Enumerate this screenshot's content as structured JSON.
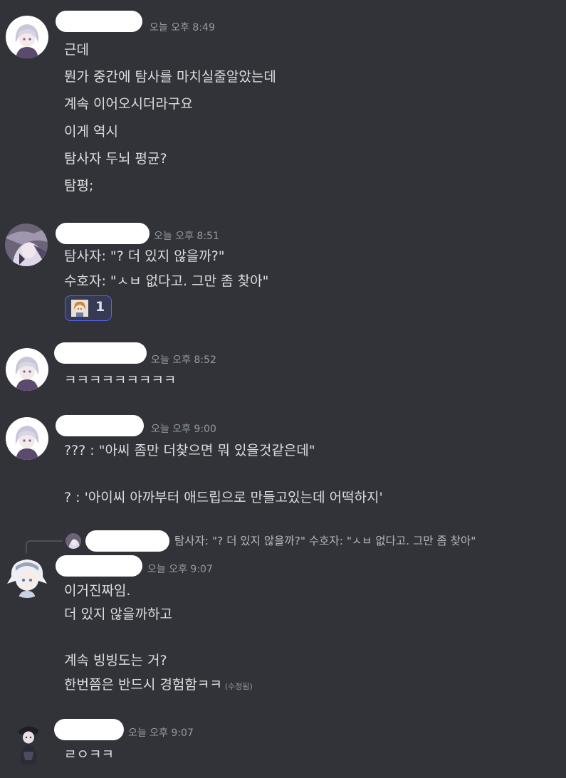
{
  "messages": [
    {
      "timestamp": "오늘 오후 8:49",
      "lines": [
        "근데",
        "뭔가 중간에 탐사를 마치실줄알았는데",
        "계속 이어오시더라구요",
        "이게 역시",
        "탐사자 두뇌 평균?",
        "탐평;"
      ]
    },
    {
      "timestamp": "오늘 오후 8:51",
      "lines": [
        "탐사자: \"? 더 있지 않을까?\"",
        "수호자: \"ㅅㅂ 없다고. 그만 좀 찾아\""
      ],
      "reaction": {
        "count": "1"
      }
    },
    {
      "timestamp": "오늘 오후 8:52",
      "lines": [
        "ㅋㅋㅋㅋㅋㅋㅋㅋㅋ"
      ]
    },
    {
      "timestamp": "오늘 오후 9:00",
      "lines": [
        "??? : \"아씨 좀만 더찾으면 뭐 있을것같은데\"",
        "? : '아이씨 아까부터 애드립으로 만들고있는데 어떡하지'"
      ]
    },
    {
      "reply_preview": "탐사자: \"? 더 있지 않을까?\" 수호자: \"ㅅㅂ 없다고. 그만 좀 찾아\"",
      "timestamp": "오늘 오후 9:07",
      "lines": [
        "이거진짜임.",
        "더 있지 않을까하고",
        "계속 빙빙도는 거?",
        "한번쯤은 반드시 경험함ㅋㅋ"
      ],
      "edited": "(수정됨)"
    },
    {
      "timestamp": "오늘 오후 9:07",
      "lines": [
        "ㄹㅇㅋㅋ"
      ]
    }
  ]
}
